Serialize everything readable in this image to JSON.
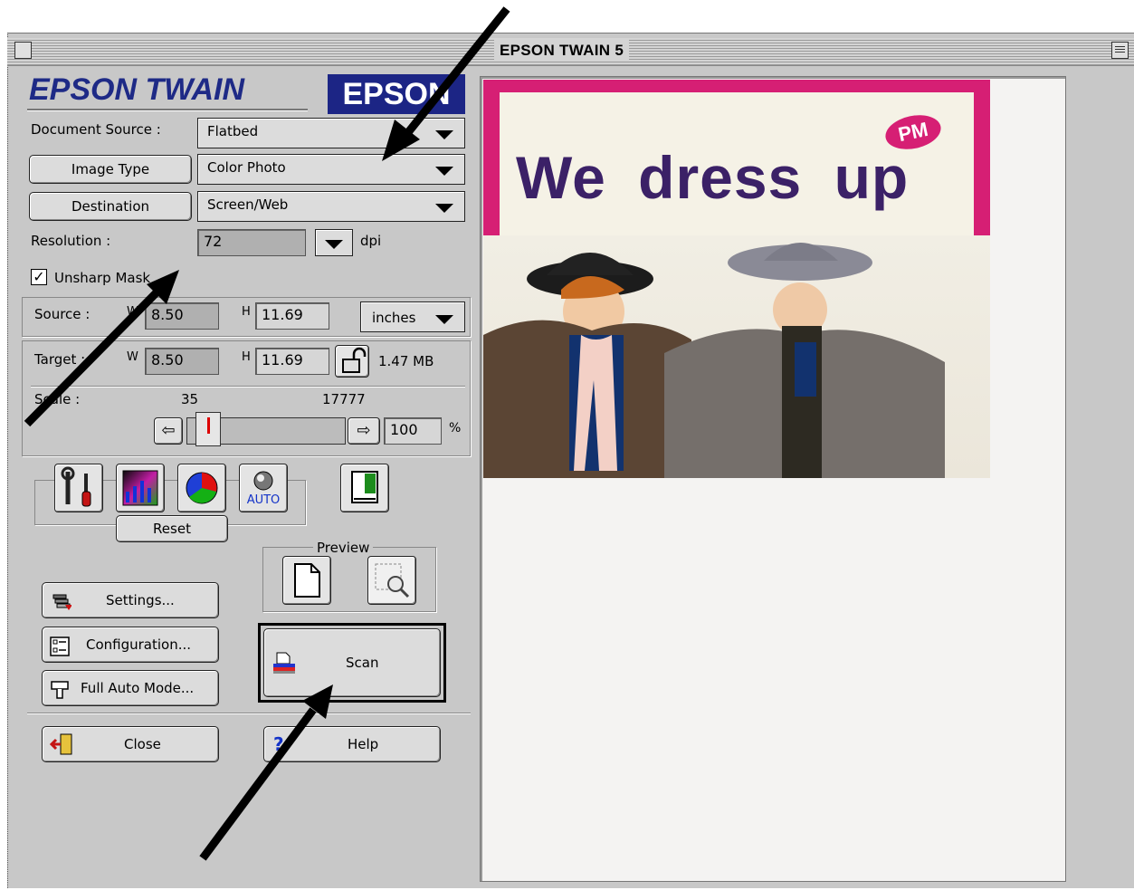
{
  "window": {
    "title": "EPSON TWAIN 5"
  },
  "logo": {
    "text": "EPSON TWAIN",
    "brand": "EPSON"
  },
  "document_source": {
    "label": "Document Source :",
    "value": "Flatbed"
  },
  "image_type": {
    "button_label": "Image Type",
    "value": "Color Photo"
  },
  "destination": {
    "button_label": "Destination",
    "value": "Screen/Web"
  },
  "resolution": {
    "label": "Resolution :",
    "value": "72",
    "unit": "dpi"
  },
  "unsharp_mask": {
    "label": "Unsharp Mask",
    "checked": true
  },
  "source": {
    "label": "Source :",
    "w_label": "W",
    "w_value": "8.50",
    "h_label": "H",
    "h_value": "11.69",
    "units": "inches"
  },
  "target": {
    "label": "Target :",
    "w_label": "W",
    "w_value": "8.50",
    "h_label": "H",
    "h_value": "11.69",
    "size": "1.47 MB"
  },
  "scale": {
    "label": "Scale :",
    "min": "35",
    "max": "17777",
    "value": "100",
    "unit": "%"
  },
  "tools": {
    "auto_label": "AUTO",
    "reset_label": "Reset"
  },
  "preview": {
    "label": "Preview"
  },
  "buttons": {
    "settings": "Settings...",
    "configuration": "Configuration...",
    "full_auto": "Full Auto Mode...",
    "scan": "Scan",
    "close": "Close",
    "help": "Help"
  },
  "preview_image": {
    "title": "We dress up",
    "badge": "PM"
  },
  "colors": {
    "logo": "#1e2a86",
    "book_border": "#d61f74",
    "book_title": "#3b2167"
  }
}
